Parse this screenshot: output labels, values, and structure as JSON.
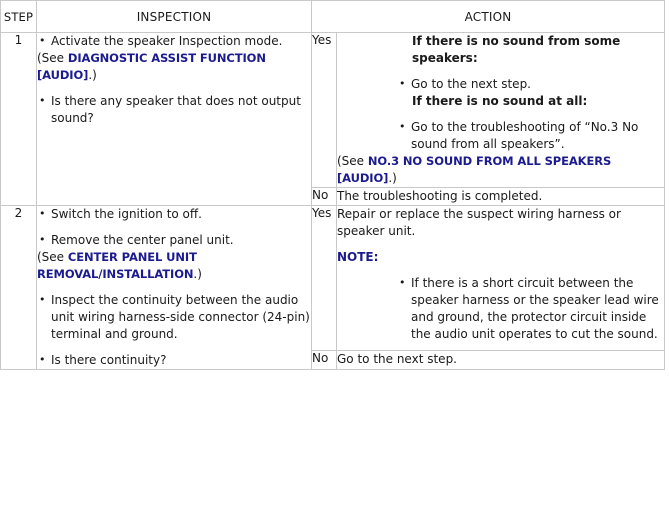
{
  "table": {
    "headers": {
      "step": "STEP",
      "inspection": "INSPECTION",
      "action": "ACTION"
    },
    "rows": [
      {
        "step": "1",
        "inspection": {
          "bullets": [
            "Activate the speaker Inspection mode.",
            "Is there any speaker that does not output sound?"
          ],
          "see_prefix": "(See ",
          "see_link": "DIAGNOSTIC ASSIST FUNCTION [AUDIO]",
          "see_suffix": ".)"
        },
        "yes": {
          "label": "Yes",
          "heading_1": "If there is no sound from some speakers:",
          "bullet_1": "Go to the next step.",
          "heading_2": "If there is no sound at all:",
          "bullet_2": "Go to the troubleshooting of “No.3 No sound from all speakers”.",
          "see_prefix": "(See ",
          "see_link": "NO.3 NO SOUND FROM ALL SPEAKERS [AUDIO]",
          "see_suffix": ".)"
        },
        "no": {
          "label": "No",
          "text": "The troubleshooting is completed."
        }
      },
      {
        "step": "2",
        "inspection": {
          "bullet_1": "Switch the ignition to off.",
          "bullet_2": "Remove the center panel unit.",
          "see_prefix": "(See ",
          "see_link": "CENTER PANEL UNIT REMOVAL/INSTALLATION",
          "see_suffix": ".)",
          "bullet_3": "Inspect the continuity between the audio unit wiring harness-side connector (24-pin) terminal and ground.",
          "bullet_4": "Is there continuity?"
        },
        "yes": {
          "label": "Yes",
          "text": "Repair or replace the suspect wiring harness or speaker unit.",
          "note_label": "NOTE:",
          "note_bullet": "If there is a short circuit between the speaker harness or the speaker lead wire and ground, the protector circuit inside the audio unit operates to cut the sound."
        },
        "no": {
          "label": "No",
          "text": "Go to the next step."
        }
      }
    ]
  },
  "colors": {
    "border": "#c9c9c9",
    "link": "#1b1b8f",
    "text": "#1a1a1a",
    "background": "#ffffff"
  }
}
